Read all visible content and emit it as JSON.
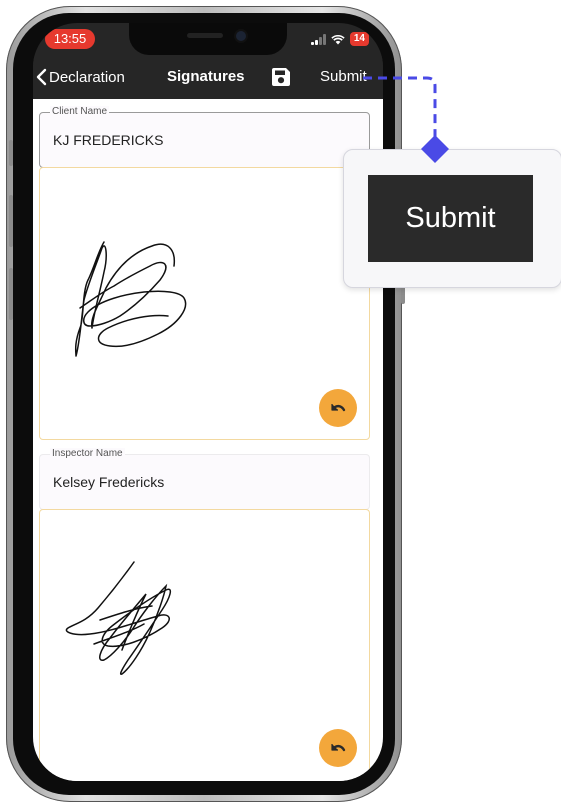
{
  "status_bar": {
    "time": "13:55",
    "battery": "14"
  },
  "nav": {
    "back_label": "Declaration",
    "title": "Signatures",
    "submit_label": "Submit"
  },
  "fields": {
    "client_name": {
      "label": "Client Name",
      "value": "KJ FREDERICKS"
    },
    "inspector_name": {
      "label": "Inspector Name",
      "value": "Kelsey Fredericks"
    }
  },
  "callout": {
    "label": "Submit"
  },
  "colors": {
    "accent_orange": "#f3a73b",
    "pad_border": "#f3d9a0",
    "callout_connector": "#4a4ae6",
    "time_badge": "#e6392e",
    "navbar_bg": "#262626"
  },
  "icons": {
    "back": "chevron-left-icon",
    "save": "save-icon",
    "undo": "undo-icon"
  }
}
